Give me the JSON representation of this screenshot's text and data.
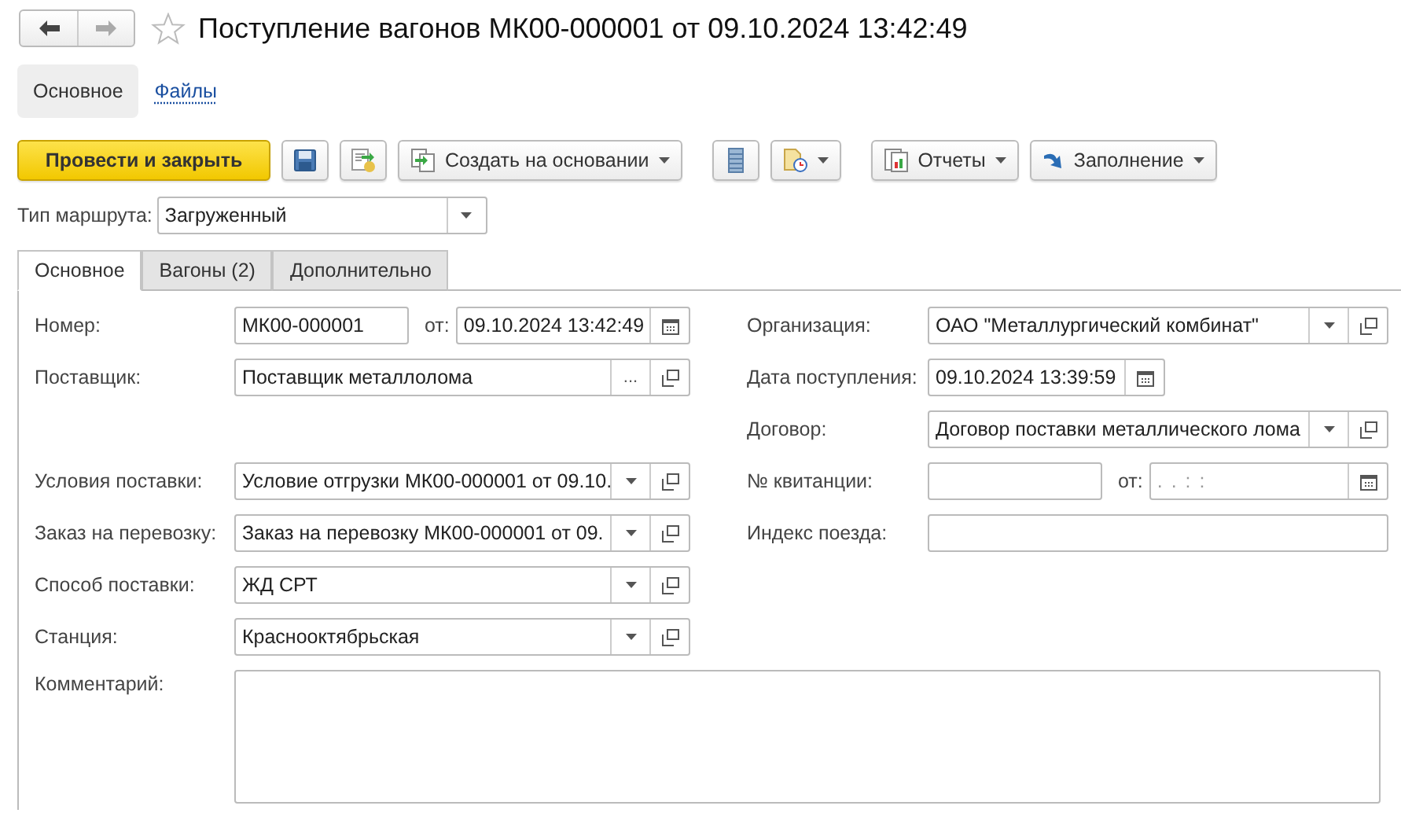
{
  "window": {
    "title": "Поступление вагонов МК00-000001 от 09.10.2024 13:42:49",
    "favorite": false
  },
  "sections": [
    {
      "label": "Основное",
      "selected": true
    },
    {
      "label": "Файлы",
      "selected": false
    }
  ],
  "toolbar": {
    "primary": "Провести и закрыть",
    "create_based": "Создать на основании",
    "reports": "Отчеты",
    "fill": "Заполнение"
  },
  "route_type": {
    "label": "Тип маршрута:",
    "value": "Загруженный"
  },
  "tabs": [
    {
      "label": "Основное",
      "selected": true
    },
    {
      "label": "Вагоны (2)",
      "selected": false
    },
    {
      "label": "Дополнительно",
      "selected": false
    }
  ],
  "left_rows": [
    {
      "label": "Номер:",
      "fields": [
        {
          "kind": "text",
          "value": "МК00-000001"
        },
        {
          "kind": "date",
          "prefix": "от:",
          "value": "09.10.2024 13:42:49"
        }
      ]
    },
    {
      "label": "Поставщик:",
      "fields": [
        {
          "kind": "choice",
          "value": "Поставщик металлолома",
          "button": "..."
        }
      ]
    },
    {
      "label": "Условия поставки:",
      "fields": [
        {
          "kind": "select",
          "value": "Условие отгрузки МК00-000001 от 09.10."
        }
      ]
    },
    {
      "label": "Заказ на перевозку:",
      "fields": [
        {
          "kind": "select",
          "value": "Заказ на перевозку МК00-000001 от 09."
        }
      ]
    },
    {
      "label": "Способ поставки:",
      "fields": [
        {
          "kind": "select",
          "value": "ЖД СРТ"
        }
      ]
    },
    {
      "label": "Станция:",
      "fields": [
        {
          "kind": "select",
          "value": "Краснооктябрьская"
        }
      ]
    }
  ],
  "right_rows": [
    {
      "label": "Организация:",
      "fields": [
        {
          "kind": "select",
          "value": "ОАО \"Металлургический комбинат\""
        }
      ]
    },
    {
      "label": "Дата поступления:",
      "fields": [
        {
          "kind": "date",
          "value": "09.10.2024 13:39:59"
        }
      ]
    },
    {
      "label": "Договор:",
      "fields": [
        {
          "kind": "select",
          "value": "Договор поставки металлического лома"
        }
      ]
    },
    {
      "label": "№ квитанции:",
      "fields": [
        {
          "kind": "text"
        },
        {
          "kind": "date",
          "prefix": "от:",
          "placeholder": ".  .         :  :"
        }
      ]
    },
    {
      "label": "Индекс поезда:",
      "fields": [
        {
          "kind": "text"
        }
      ]
    }
  ],
  "comment": {
    "label": "Комментарий:"
  }
}
